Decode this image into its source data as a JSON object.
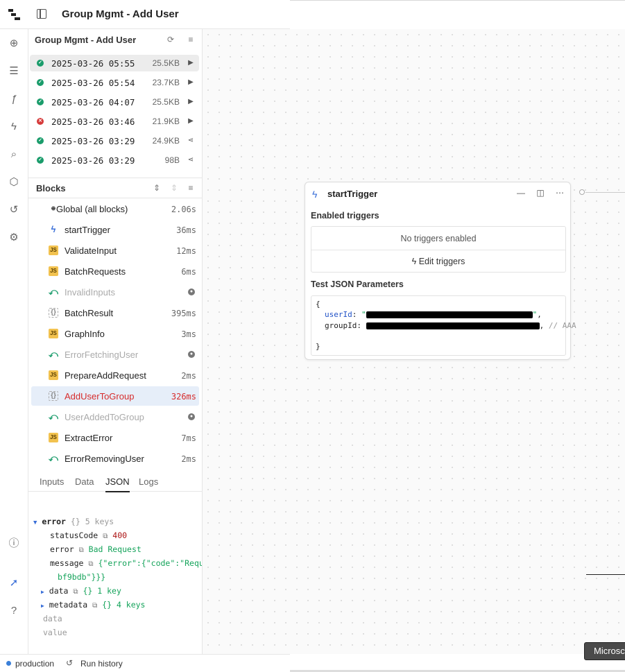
{
  "app": {
    "title": "Group Mgmt - Add User"
  },
  "rail": {
    "icons": [
      "plus-circle-icon",
      "list-icon",
      "function-icon",
      "bolt-icon",
      "search-icon",
      "package-icon",
      "history-icon",
      "gear-icon",
      "help-icon",
      "rocket-icon",
      "help-icon"
    ]
  },
  "panel": {
    "title": "Group Mgmt - Add User",
    "runs": [
      {
        "time": "2025-03-26 05:55",
        "size": "25.5KB",
        "status": "success",
        "action": "play-icon"
      },
      {
        "time": "2025-03-26 05:54",
        "size": "23.7KB",
        "status": "success",
        "action": "play-icon"
      },
      {
        "time": "2025-03-26 04:07",
        "size": "25.5KB",
        "status": "success",
        "action": "play-icon"
      },
      {
        "time": "2025-03-26 03:46",
        "size": "21.9KB",
        "status": "error",
        "action": "play-icon"
      },
      {
        "time": "2025-03-26 03:29",
        "size": "24.9KB",
        "status": "success",
        "action": "share-icon"
      },
      {
        "time": "2025-03-26 03:29",
        "size": "98B",
        "status": "success",
        "action": "share-icon"
      }
    ],
    "blocks_label": "Blocks",
    "blocks": [
      {
        "name": "Global (all blocks)",
        "duration": "2.06s",
        "type": "global",
        "state": "normal"
      },
      {
        "name": "startTrigger",
        "duration": "36ms",
        "type": "trigger",
        "state": "normal"
      },
      {
        "name": "ValidateInput",
        "duration": "12ms",
        "type": "js",
        "state": "normal"
      },
      {
        "name": "BatchRequests",
        "duration": "6ms",
        "type": "js",
        "state": "normal"
      },
      {
        "name": "InvalidInputs",
        "duration": "",
        "type": "branch",
        "state": "skipped"
      },
      {
        "name": "BatchResult",
        "duration": "395ms",
        "type": "http",
        "state": "normal"
      },
      {
        "name": "GraphInfo",
        "duration": "3ms",
        "type": "js",
        "state": "normal"
      },
      {
        "name": "ErrorFetchingUser",
        "duration": "",
        "type": "branch",
        "state": "skipped"
      },
      {
        "name": "PrepareAddRequest",
        "duration": "2ms",
        "type": "js",
        "state": "normal"
      },
      {
        "name": "AddUserToGroup",
        "duration": "326ms",
        "type": "http",
        "state": "error"
      },
      {
        "name": "UserAddedToGroup",
        "duration": "",
        "type": "branch",
        "state": "skipped"
      },
      {
        "name": "ExtractError",
        "duration": "7ms",
        "type": "js",
        "state": "normal"
      },
      {
        "name": "ErrorRemovingUser",
        "duration": "2ms",
        "type": "branch",
        "state": "normal"
      }
    ],
    "tabs": [
      "Inputs",
      "Data",
      "JSON",
      "Logs"
    ],
    "active_tab": "JSON",
    "json": {
      "root_key": "error",
      "root_meta": "{} 5 keys",
      "status_key": "statusCode",
      "status_val": "400",
      "error_key": "error",
      "error_val": "Bad Request",
      "message_key": "message",
      "message_val": "{\"error\":{\"code\":\"Reque",
      "message_cont": "bf9bdb\"}}}",
      "data_key": "data",
      "data_meta": "{} 1 key",
      "metadata_key": "metadata",
      "metadata_meta": "{} 4 keys",
      "extra1": "data",
      "extra2": "value"
    }
  },
  "node": {
    "title": "startTrigger",
    "enabled_label": "Enabled triggers",
    "no_triggers": "No triggers enabled",
    "edit_triggers": "Edit triggers",
    "test_label": "Test JSON Parameters",
    "code": {
      "open": "{",
      "k1": "userId",
      "k2": "groupId",
      "comment": "// AAA",
      "close": "}"
    }
  },
  "toast": {
    "text": "Microsc"
  },
  "statusbar": {
    "env": "production",
    "history": "Run history"
  }
}
